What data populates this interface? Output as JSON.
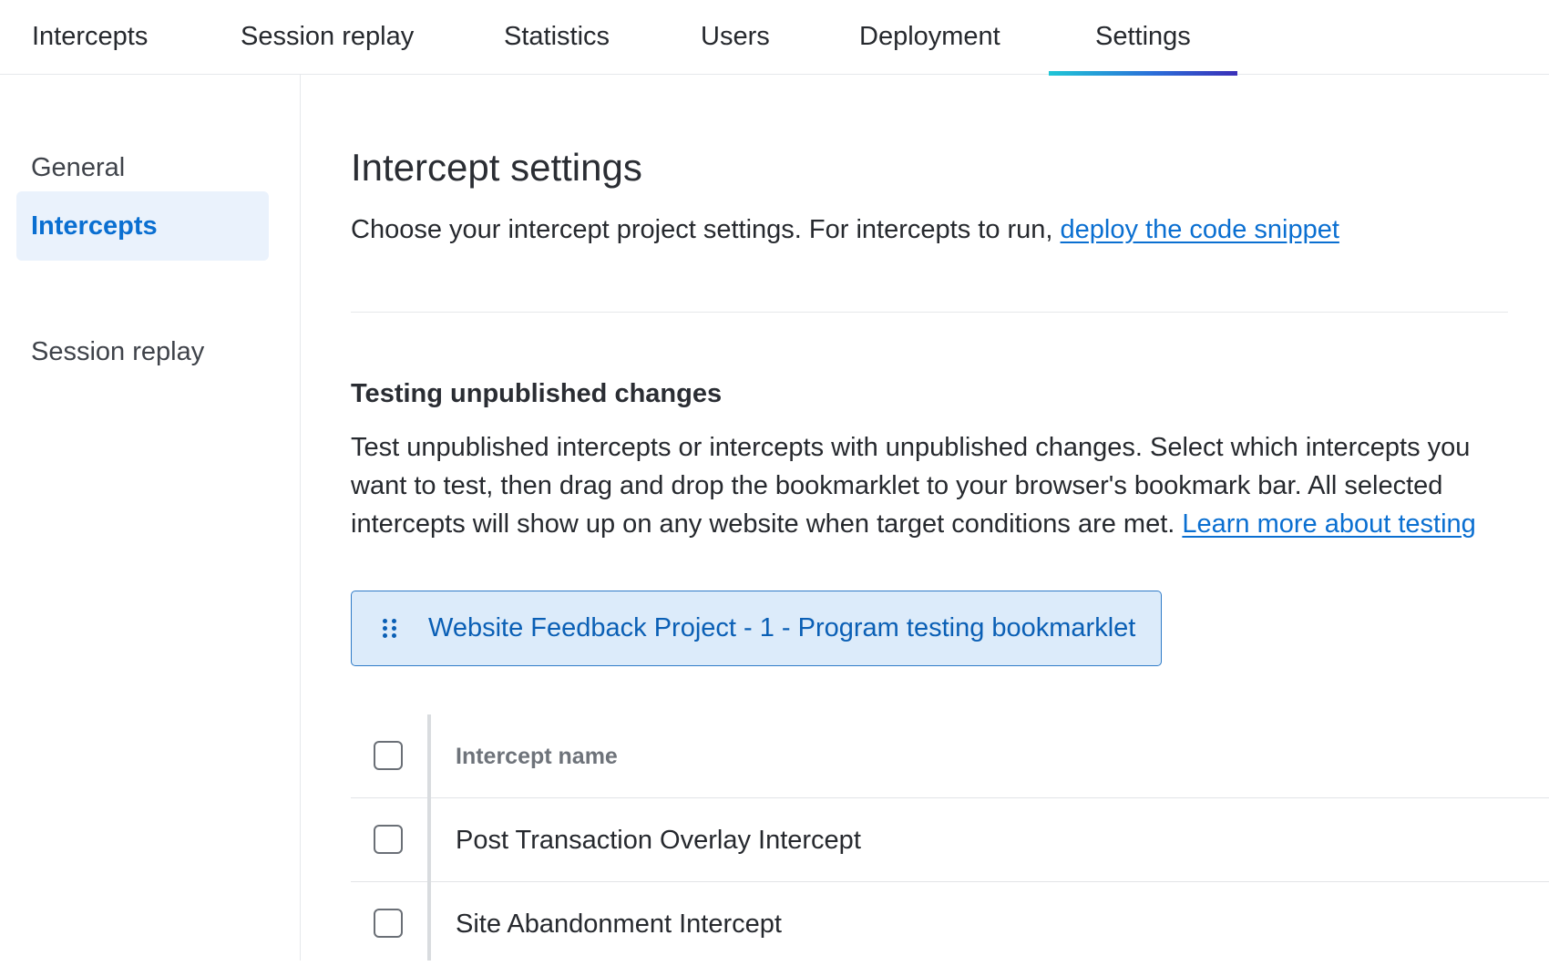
{
  "topnav": {
    "tabs": [
      {
        "label": "Intercepts"
      },
      {
        "label": "Session replay"
      },
      {
        "label": "Statistics"
      },
      {
        "label": "Users"
      },
      {
        "label": "Deployment"
      },
      {
        "label": "Settings",
        "active": true
      }
    ]
  },
  "sidebar": {
    "items": [
      {
        "label": "General"
      },
      {
        "label": "Intercepts",
        "active": true
      },
      {
        "label": "Session replay"
      }
    ]
  },
  "main": {
    "title": "Intercept settings",
    "intro_text": "Choose your intercept project settings. For intercepts to run, ",
    "intro_link": "deploy the code snippet",
    "testing": {
      "title": "Testing unpublished changes",
      "desc_line1": "Test unpublished intercepts or intercepts with unpublished changes. Select which intercepts you",
      "desc_line2": "want to test, then drag and drop the bookmarklet to your browser's bookmark bar. All selected",
      "desc_line3": "intercepts will show up on any website when target conditions are met. ",
      "learn_more_link": "Learn more about testing",
      "bookmarklet_label": "Website Feedback Project - 1 - Program testing bookmarklet",
      "bookmarklet_icon": "drag-grip-icon"
    },
    "table": {
      "header": "Intercept name",
      "rows": [
        {
          "name": "Post Transaction Overlay Intercept",
          "checked": false
        },
        {
          "name": "Site Abandonment Intercept",
          "checked": false
        }
      ]
    }
  },
  "colors": {
    "accent": "#0a6fd1",
    "active_sidebar_bg": "#eaf2fc",
    "bookmarklet_bg": "#dcebfa",
    "tab_underline_start": "#1fc6d6",
    "tab_underline_end": "#3a2fb8"
  }
}
